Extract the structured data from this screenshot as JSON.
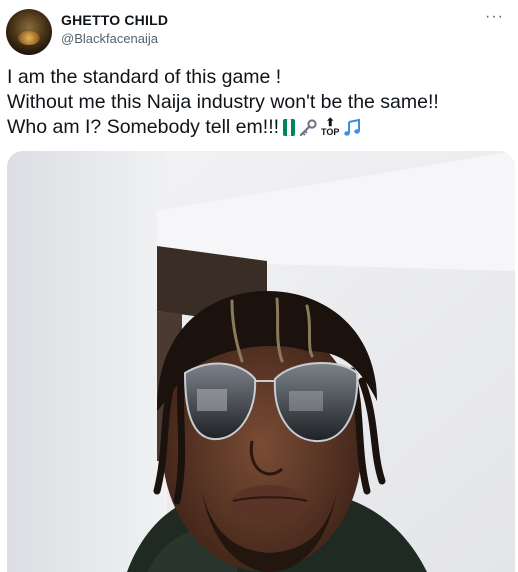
{
  "tweet": {
    "author": {
      "display_name": "GHETTO CHILD",
      "handle": "@Blackfacenaija"
    },
    "more_icon": "more-options-icon",
    "text": {
      "line1": "I am the standard of this game !",
      "line2": "Without me this Naija industry won't be the same!!",
      "line3": "Who am I? Somebody tell em!!!"
    },
    "emojis": [
      "nigeria-flag-icon",
      "key-icon",
      "top-arrow-icon",
      "musical-notes-icon"
    ],
    "top_emoji_label": "TOP",
    "media": {
      "type": "photo",
      "subject": "man-with-dreadlocks-and-aviator-sunglasses"
    }
  },
  "colors": {
    "text": "#0f1419",
    "secondary": "#536471",
    "flag_green": "#008751",
    "music_blue": "#3b8eea"
  }
}
